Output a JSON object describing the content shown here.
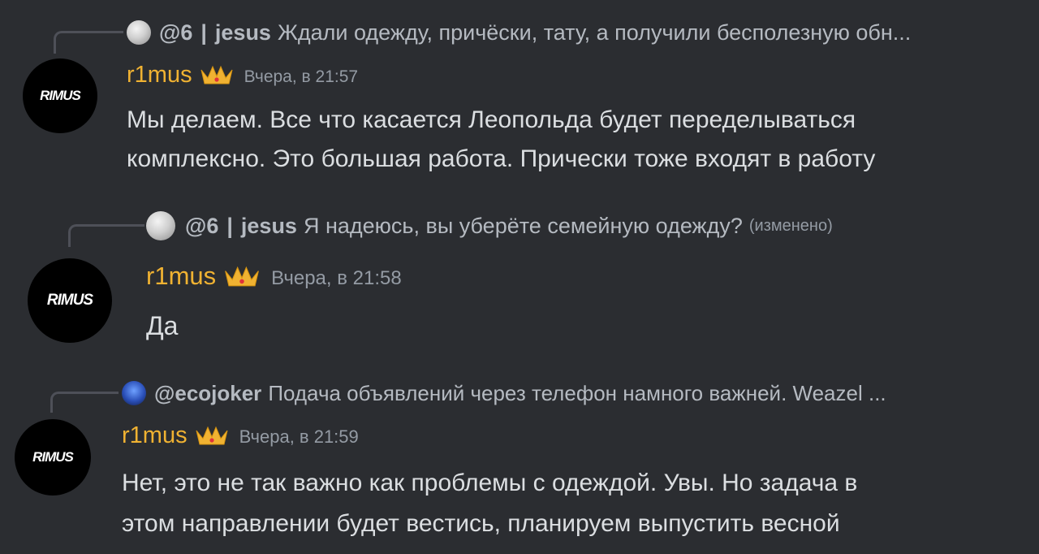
{
  "messages": [
    {
      "reply": {
        "user": "@6",
        "separator": "|",
        "nickname": "jesus",
        "text": "Ждали одежду, причёски, тату, а получили бесполезную обн...",
        "edited": "",
        "avatar_icon": "ghost-avatar-icon"
      },
      "avatar_text": "RIMUS",
      "author": "r1mus",
      "timestamp": "Вчера, в 21:57",
      "lines": [
        "Мы делаем. Все что касается Леопольда будет переделываться",
        "комплексно. Это большая работа. Прически тоже входят в работу"
      ]
    },
    {
      "reply": {
        "user": "@6",
        "separator": "|",
        "nickname": "jesus",
        "text": "Я надеюсь, вы уберёте семейную одежду?",
        "edited": "(изменено)",
        "avatar_icon": "ghost-avatar-icon"
      },
      "avatar_text": "RIMUS",
      "author": "r1mus",
      "timestamp": "Вчера, в 21:58",
      "lines": [
        "Да"
      ]
    },
    {
      "reply": {
        "user": "@ecojoker",
        "separator": "",
        "nickname": "",
        "text": "Подача объявлений через телефон намного важней. Weazel ...",
        "edited": "",
        "avatar_icon": "joker-avatar-icon"
      },
      "avatar_text": "RIMUS",
      "author": "r1mus",
      "timestamp": "Вчера, в 21:59",
      "lines": [
        "Нет, это не так важно как проблемы с одеждой. Увы. Но задача в",
        "этом направлении будет вестись, планируем выпустить весной"
      ]
    }
  ],
  "colors": {
    "background": "#2b2d31",
    "author": "#f0b232",
    "crown": "#f0b232",
    "timestamp": "#949ba4",
    "text": "#dbdee1"
  }
}
